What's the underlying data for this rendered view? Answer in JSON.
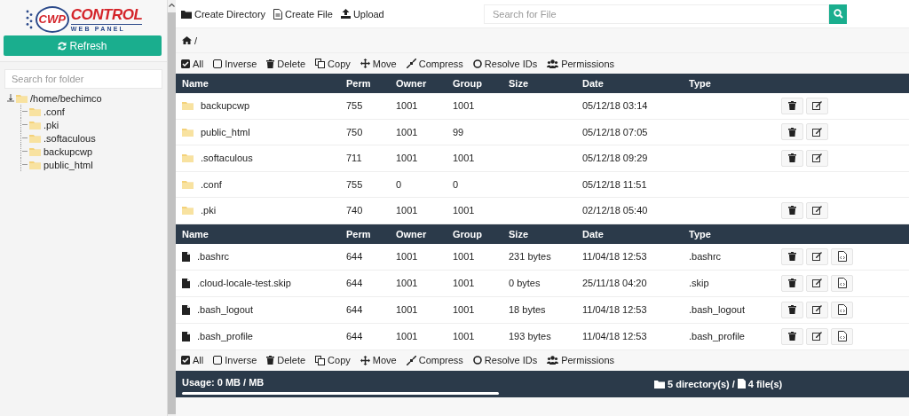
{
  "logo": {
    "badge": "CWP",
    "name": "CONTROL",
    "tagline": "WEB PANEL"
  },
  "refresh_button": {
    "label": "Refresh"
  },
  "folder_search": {
    "placeholder": "Search for folder"
  },
  "tree": [
    {
      "label": "/home/bechimco",
      "expanded": true,
      "children": [
        {
          "label": ".conf"
        },
        {
          "label": ".pki"
        },
        {
          "label": ".softaculous"
        },
        {
          "label": "backupcwp"
        },
        {
          "label": "public_html"
        }
      ]
    }
  ],
  "toolbar": [
    {
      "kind": "folder",
      "label": "Create Directory"
    },
    {
      "kind": "file",
      "label": "Create File"
    },
    {
      "kind": "upload",
      "label": "Upload"
    }
  ],
  "file_search": {
    "placeholder": "Search for File"
  },
  "breadcrumb": {
    "path": "/"
  },
  "actions_top": [
    {
      "kind": "check-all",
      "label": "All"
    },
    {
      "kind": "inverse",
      "label": "Inverse"
    },
    {
      "kind": "delete",
      "label": "Delete"
    },
    {
      "kind": "copy",
      "label": "Copy"
    },
    {
      "kind": "move",
      "label": "Move"
    },
    {
      "kind": "compress",
      "label": "Compress"
    },
    {
      "kind": "resolve",
      "label": "Resolve IDs"
    },
    {
      "kind": "permissions",
      "label": "Permissions"
    }
  ],
  "directories": {
    "columns": [
      "Name",
      "Perm",
      "Owner",
      "Group",
      "Size",
      "Date",
      "Type"
    ],
    "rows": [
      {
        "name": "backupcwp",
        "perm": "755",
        "owner": "1001",
        "group": "1001",
        "date": "05/12/18 03:14",
        "actions": [
          {
            "kind": "delete"
          },
          {
            "kind": "edit"
          }
        ]
      },
      {
        "name": "public_html",
        "perm": "750",
        "owner": "1001",
        "group": "99",
        "date": "05/12/18 07:05",
        "actions": [
          {
            "kind": "delete"
          },
          {
            "kind": "edit"
          }
        ]
      },
      {
        "name": ".softaculous",
        "perm": "711",
        "owner": "1001",
        "group": "1001",
        "date": "05/12/18 09:29",
        "actions": [
          {
            "kind": "delete"
          },
          {
            "kind": "edit"
          }
        ]
      },
      {
        "name": ".conf",
        "perm": "755",
        "owner": "0",
        "group": "0",
        "date": "05/12/18 11:51"
      },
      {
        "name": ".pki",
        "perm": "740",
        "owner": "1001",
        "group": "1001",
        "date": "02/12/18 05:40",
        "actions": [
          {
            "kind": "delete"
          },
          {
            "kind": "edit"
          }
        ]
      }
    ]
  },
  "files": {
    "columns": [
      "Name",
      "Perm",
      "Owner",
      "Group",
      "Size",
      "Date",
      "Type"
    ],
    "rows": [
      {
        "name": ".bashrc",
        "perm": "644",
        "owner": "1001",
        "group": "1001",
        "size": "231 bytes",
        "date": "11/04/18 12:53",
        "type": ".bashrc",
        "actions": [
          {
            "kind": "delete"
          },
          {
            "kind": "edit"
          },
          {
            "kind": "view"
          }
        ]
      },
      {
        "name": ".cloud-locale-test.skip",
        "perm": "644",
        "owner": "1001",
        "group": "1001",
        "size": "0 bytes",
        "date": "25/11/18 04:20",
        "type": ".skip",
        "actions": [
          {
            "kind": "delete"
          },
          {
            "kind": "edit"
          },
          {
            "kind": "view"
          }
        ]
      },
      {
        "name": ".bash_logout",
        "perm": "644",
        "owner": "1001",
        "group": "1001",
        "size": "18 bytes",
        "date": "11/04/18 12:53",
        "type": ".bash_logout",
        "actions": [
          {
            "kind": "delete"
          },
          {
            "kind": "edit"
          },
          {
            "kind": "view"
          }
        ]
      },
      {
        "name": ".bash_profile",
        "perm": "644",
        "owner": "1001",
        "group": "1001",
        "size": "193 bytes",
        "date": "11/04/18 12:53",
        "type": ".bash_profile",
        "actions": [
          {
            "kind": "delete"
          },
          {
            "kind": "edit"
          },
          {
            "kind": "view"
          }
        ]
      }
    ]
  },
  "actions_bottom": [
    {
      "kind": "check-all",
      "label": "All"
    },
    {
      "kind": "inverse",
      "label": "Inverse"
    },
    {
      "kind": "delete",
      "label": "Delete"
    },
    {
      "kind": "copy",
      "label": "Copy"
    },
    {
      "kind": "move",
      "label": "Move"
    },
    {
      "kind": "compress",
      "label": "Compress"
    },
    {
      "kind": "resolve",
      "label": "Resolve IDs"
    },
    {
      "kind": "permissions",
      "label": "Permissions"
    }
  ],
  "footer": {
    "usage": "Usage: 0 MB / MB",
    "directories": "5 directory(s)",
    "separator": "/",
    "files": "4 file(s)"
  }
}
